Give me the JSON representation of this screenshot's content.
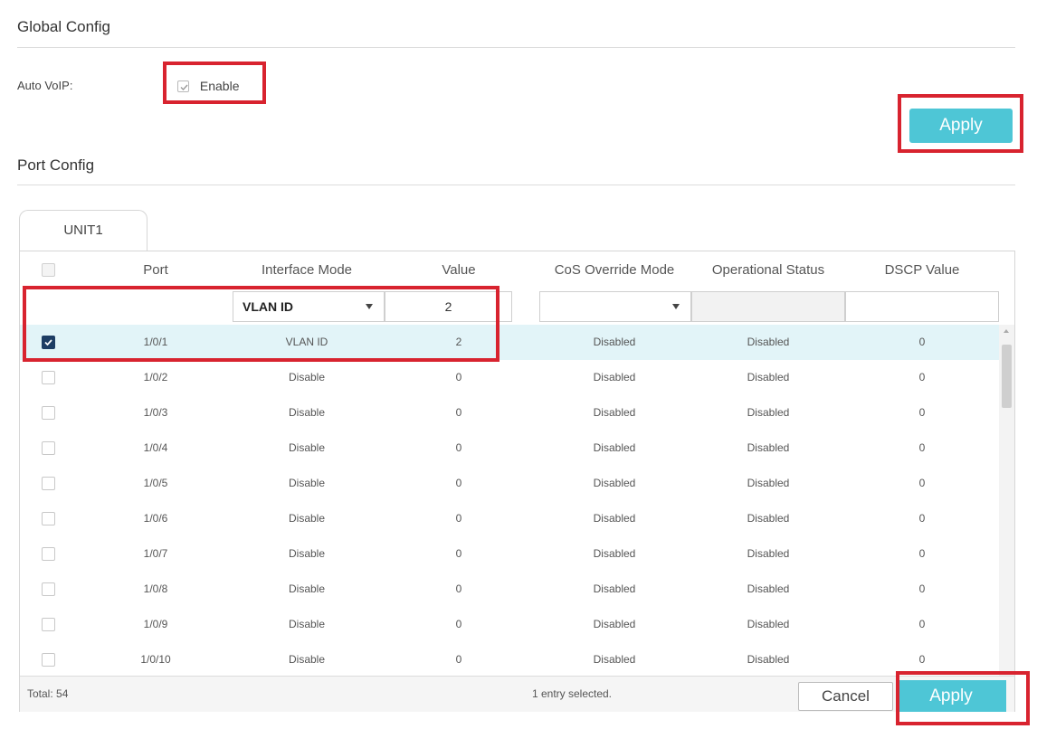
{
  "global_config": {
    "title": "Global Config",
    "auto_voip_label": "Auto VoIP:",
    "enable_label": "Enable",
    "enable_checked": true,
    "apply_label": "Apply"
  },
  "port_config": {
    "title": "Port Config",
    "tab_label": "UNIT1",
    "columns": [
      "Port",
      "Interface Mode",
      "Value",
      "CoS Override Mode",
      "Operational Status",
      "DSCP Value"
    ],
    "edit_row": {
      "interface_mode": "VLAN ID",
      "value": "2",
      "cos_override_mode": "",
      "dscp_value": ""
    },
    "rows": [
      {
        "checked": true,
        "port": "1/0/1",
        "interface_mode": "VLAN ID",
        "value": "2",
        "cos": "Disabled",
        "status": "Disabled",
        "dscp": "0"
      },
      {
        "checked": false,
        "port": "1/0/2",
        "interface_mode": "Disable",
        "value": "0",
        "cos": "Disabled",
        "status": "Disabled",
        "dscp": "0"
      },
      {
        "checked": false,
        "port": "1/0/3",
        "interface_mode": "Disable",
        "value": "0",
        "cos": "Disabled",
        "status": "Disabled",
        "dscp": "0"
      },
      {
        "checked": false,
        "port": "1/0/4",
        "interface_mode": "Disable",
        "value": "0",
        "cos": "Disabled",
        "status": "Disabled",
        "dscp": "0"
      },
      {
        "checked": false,
        "port": "1/0/5",
        "interface_mode": "Disable",
        "value": "0",
        "cos": "Disabled",
        "status": "Disabled",
        "dscp": "0"
      },
      {
        "checked": false,
        "port": "1/0/6",
        "interface_mode": "Disable",
        "value": "0",
        "cos": "Disabled",
        "status": "Disabled",
        "dscp": "0"
      },
      {
        "checked": false,
        "port": "1/0/7",
        "interface_mode": "Disable",
        "value": "0",
        "cos": "Disabled",
        "status": "Disabled",
        "dscp": "0"
      },
      {
        "checked": false,
        "port": "1/0/8",
        "interface_mode": "Disable",
        "value": "0",
        "cos": "Disabled",
        "status": "Disabled",
        "dscp": "0"
      },
      {
        "checked": false,
        "port": "1/0/9",
        "interface_mode": "Disable",
        "value": "0",
        "cos": "Disabled",
        "status": "Disabled",
        "dscp": "0"
      },
      {
        "checked": false,
        "port": "1/0/10",
        "interface_mode": "Disable",
        "value": "0",
        "cos": "Disabled",
        "status": "Disabled",
        "dscp": "0"
      }
    ],
    "footer": {
      "total": "Total: 54",
      "selected": "1 entry selected.",
      "cancel_label": "Cancel",
      "apply_label": "Apply"
    }
  },
  "colors": {
    "accent": "#4ec6d6",
    "highlight_box": "#d8232f",
    "selected_row": "#e2f4f8",
    "checkbox_checked": "#1d3d64"
  }
}
